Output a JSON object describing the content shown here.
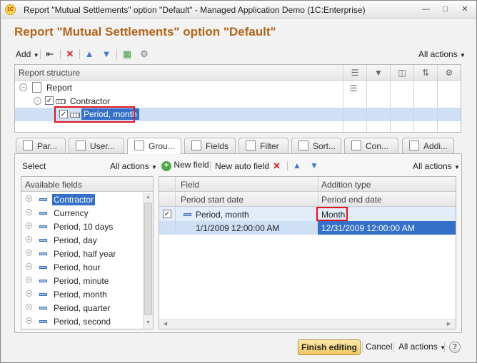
{
  "window": {
    "title": "Report \"Mutual Settlements\" option \"Default\" - Managed Application Demo  (1C:Enterprise)",
    "app_icon_text": "1C"
  },
  "page_title": "Report \"Mutual Settlements\" option \"Default\"",
  "toolbar": {
    "add_label": "Add",
    "all_actions_label": "All actions",
    "icons": [
      "add-structure-icon",
      "delete-icon",
      "move-up-icon",
      "move-down-icon",
      "add-group-icon",
      "settings-group-icon"
    ]
  },
  "report_structure": {
    "header": "Report structure",
    "column_icons": [
      "grouping-icon",
      "filter-icon",
      "fields-icon",
      "sort-icon",
      "settings-icon"
    ],
    "items": [
      {
        "label": "Report"
      },
      {
        "label": "Contractor",
        "checked": true
      },
      {
        "label": "Period, month",
        "checked": true,
        "selected": true
      }
    ]
  },
  "tabs": [
    {
      "label": "Par..."
    },
    {
      "label": "User..."
    },
    {
      "label": "Grou...",
      "active": true
    },
    {
      "label": "Fields"
    },
    {
      "label": "Filter"
    },
    {
      "label": "Sort..."
    },
    {
      "label": "Con..."
    },
    {
      "label": "Addi..."
    }
  ],
  "grouping_panel": {
    "select_label": "Select",
    "left_all_actions": "All actions",
    "new_field_label": "New field",
    "new_auto_field_label": "New auto field",
    "right_all_actions": "All actions",
    "available_fields_header": "Available fields",
    "available_fields": [
      {
        "label": "Contractor",
        "selected": true
      },
      {
        "label": "Currency"
      },
      {
        "label": "Period, 10 days"
      },
      {
        "label": "Period, day"
      },
      {
        "label": "Period, half year"
      },
      {
        "label": "Period, hour"
      },
      {
        "label": "Period, minute"
      },
      {
        "label": "Period, month"
      },
      {
        "label": "Period, quarter"
      },
      {
        "label": "Period, second"
      }
    ]
  },
  "grid": {
    "headers": {
      "field": "Field",
      "addition_type": "Addition type",
      "period_start": "Period start date",
      "period_end": "Period end date"
    },
    "row": {
      "checked": true,
      "field": "Period, month",
      "addition_type": "Month",
      "start_date": "1/1/2009 12:00:00 AM",
      "end_date": "12/31/2009 12:00:00 AM"
    }
  },
  "footer": {
    "finish_label": "Finish editing",
    "cancel_label": "Cancel",
    "all_actions_label": "All actions",
    "help_label": "?"
  },
  "colors": {
    "title": "#b1651a",
    "selection": "#3470c8",
    "highlight_box": "#e0141e"
  }
}
